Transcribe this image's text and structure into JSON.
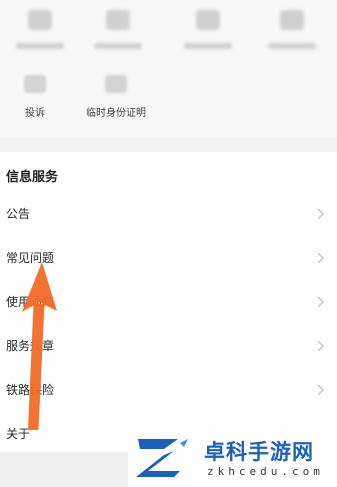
{
  "services": {
    "items": [
      {
        "label": "投诉",
        "icon": "complaint-icon"
      },
      {
        "label": "临时身份证明",
        "icon": "id-card-icon"
      }
    ]
  },
  "info": {
    "title": "信息服务",
    "rows": [
      {
        "label": "公告"
      },
      {
        "label": "常见问题"
      },
      {
        "label": "使用须知"
      },
      {
        "label": "服务规章"
      },
      {
        "label": "铁路保险"
      },
      {
        "label": "关于"
      }
    ]
  },
  "watermark": {
    "text": "卓科手游网",
    "url": "zkhcedu.com"
  },
  "colors": {
    "arrow": "#f26b2a",
    "brand": "#1e5fb8",
    "chevron": "#bdbdbd"
  }
}
